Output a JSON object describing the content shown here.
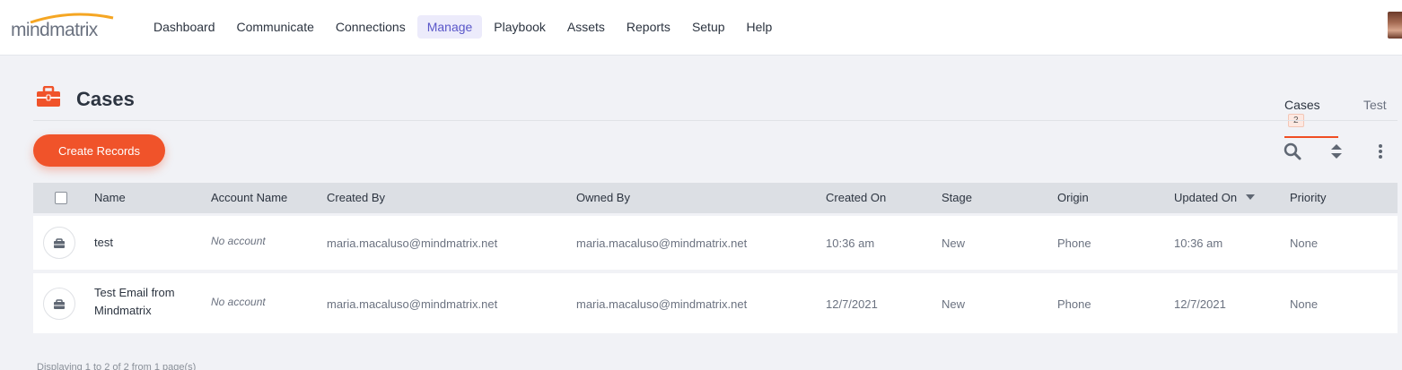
{
  "brand": {
    "name": "mindmatrix",
    "accent": "#f0532a",
    "nav_active_color": "#5a57c9"
  },
  "nav": {
    "items": [
      {
        "label": "Dashboard"
      },
      {
        "label": "Communicate"
      },
      {
        "label": "Connections"
      },
      {
        "label": "Manage",
        "active": true
      },
      {
        "label": "Playbook"
      },
      {
        "label": "Assets"
      },
      {
        "label": "Reports"
      },
      {
        "label": "Setup"
      },
      {
        "label": "Help"
      }
    ]
  },
  "page": {
    "icon": "briefcase-icon",
    "title": "Cases",
    "tabs": [
      {
        "label": "Cases",
        "count": "2",
        "active": true
      },
      {
        "label": "Test"
      }
    ]
  },
  "toolbar": {
    "create_label": "Create Records",
    "icons": [
      "search-icon",
      "sort-icon",
      "more-vertical-icon"
    ]
  },
  "table": {
    "columns": [
      "Name",
      "Account Name",
      "Created By",
      "Owned By",
      "Created On",
      "Stage",
      "Origin",
      "Updated On",
      "Priority"
    ],
    "sorted_column": "Updated On",
    "rows": [
      {
        "name": "test",
        "account": "No account",
        "created_by": "maria.macaluso@mindmatrix.net",
        "owned_by": "maria.macaluso@mindmatrix.net",
        "created_on": "10:36 am",
        "stage": "New",
        "origin": "Phone",
        "updated_on": "10:36 am",
        "priority": "None"
      },
      {
        "name": "Test Email from Mindmatrix",
        "account": "No account",
        "created_by": "maria.macaluso@mindmatrix.net",
        "owned_by": "maria.macaluso@mindmatrix.net",
        "created_on": "12/7/2021",
        "stage": "New",
        "origin": "Phone",
        "updated_on": "12/7/2021",
        "priority": "None"
      }
    ]
  },
  "footer": {
    "text": "Displaying 1 to 2 of 2 from 1 page(s)"
  }
}
